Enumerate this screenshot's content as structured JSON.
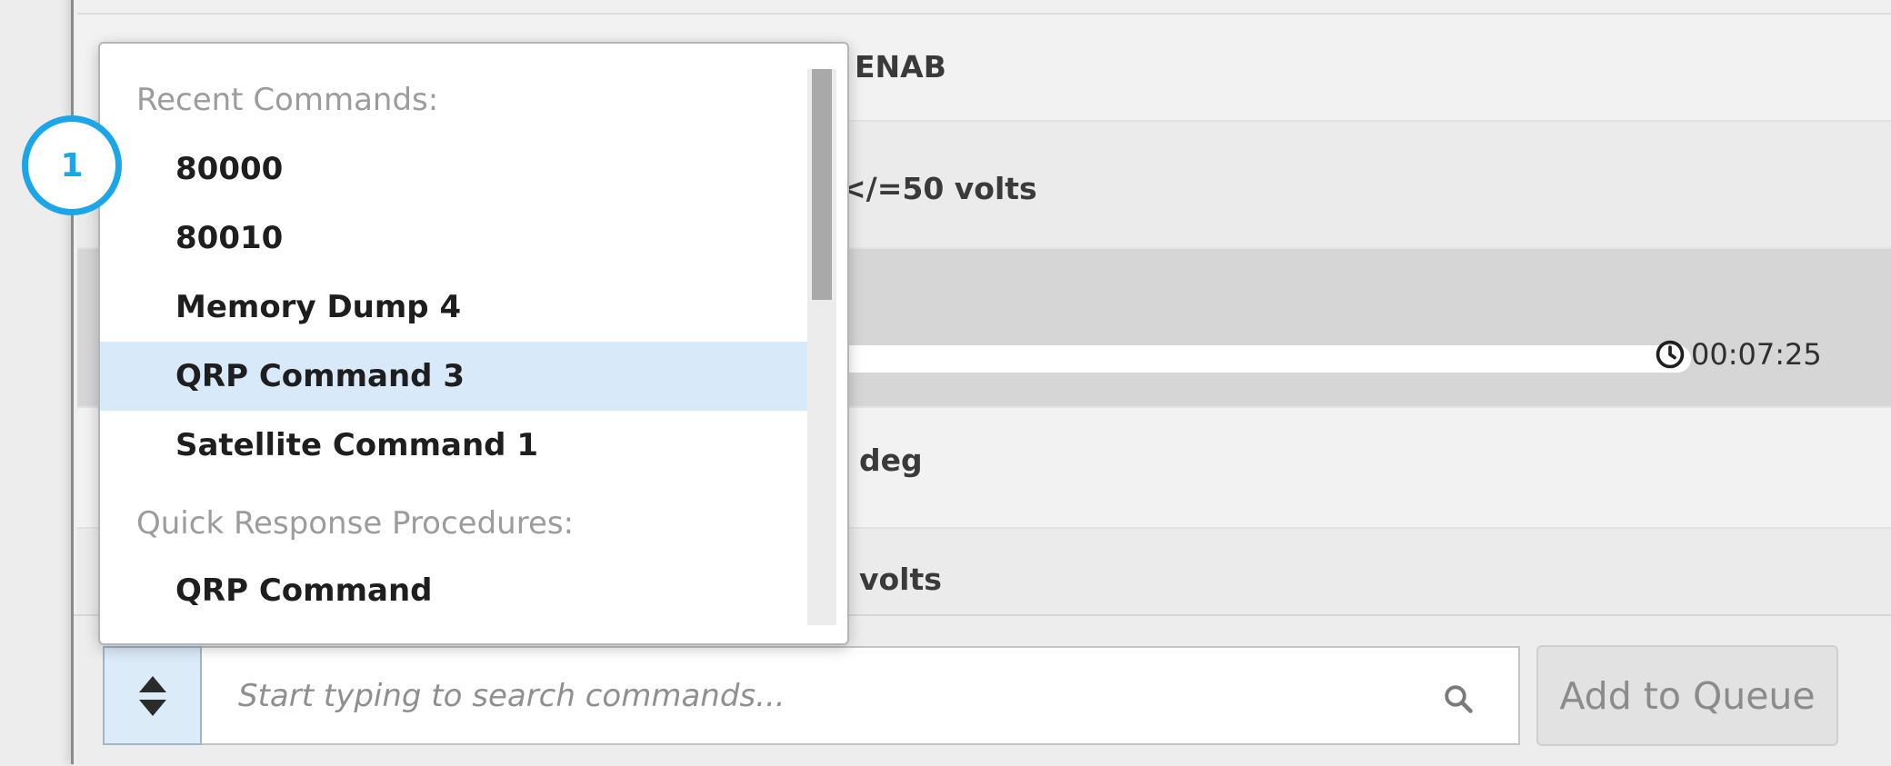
{
  "queue": {
    "rows": [
      {
        "text": "ENAB"
      },
      {
        "text": "</=50 volts"
      },
      {
        "text": ""
      },
      {
        "text": "deg"
      },
      {
        "text": "volts"
      }
    ],
    "active_row": {
      "progress_percent": 100,
      "elapsed_time": "00:07:25"
    }
  },
  "dropdown": {
    "sections": [
      {
        "header": "Recent Commands:",
        "items": [
          "80000",
          "80010",
          "Memory Dump 4",
          "QRP Command 3",
          "Satellite Command 1"
        ]
      },
      {
        "header": "Quick Response Procedures:",
        "items": [
          "QRP Command"
        ]
      }
    ],
    "selected_item": "QRP Command 3"
  },
  "search": {
    "placeholder": "Start typing to search commands..."
  },
  "add_button": {
    "label": "Add to Queue"
  },
  "step_marker": {
    "number": "1"
  },
  "colors": {
    "accent": "#1aa6e8",
    "selection": "#d8eaf9",
    "panel_bg": "#f0f0f0",
    "active_row_bg": "#d6d6d6"
  },
  "icons": {
    "sort_toggle": "sort-up-down-icon",
    "search": "search-icon",
    "timer": "clock-icon"
  }
}
